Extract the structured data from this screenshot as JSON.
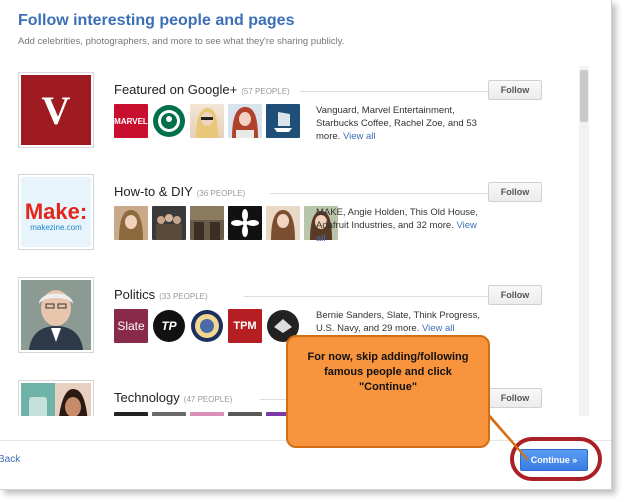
{
  "header": {
    "title": "Follow interesting people and pages",
    "subtitle": "Add celebrities, photographers, and more to see what they're sharing publicly."
  },
  "categories": [
    {
      "title": "Featured on Google+",
      "count": "(57 PEOPLE)",
      "follow_label": "Follow",
      "description": "Vanguard, Marvel Entertainment, Starbucks Coffee, Rachel Zoe, and 53 more.",
      "link": "View all"
    },
    {
      "title": "How-to & DIY",
      "count": "(36 PEOPLE)",
      "follow_label": "Follow",
      "description": "MAKE, Angie Holden, This Old House, Adafruit Industries, and 32 more.",
      "link": "View all"
    },
    {
      "title": "Politics",
      "count": "(33 PEOPLE)",
      "follow_label": "Follow",
      "description": "Bernie Sanders, Slate, Think Progress, U.S. Navy, and 29 more.",
      "link": "View all"
    },
    {
      "title": "Technology",
      "count": "(47 PEOPLE)",
      "follow_label": "Follow"
    }
  ],
  "logos": {
    "vanguard": "V",
    "make": "Make:",
    "makezine": "makezine.com",
    "marvel": "MARVEL",
    "slate": "Slate",
    "tp": "TP",
    "tpm": "TPM"
  },
  "footer": {
    "back_label": "Back",
    "continue_label": "Continue »"
  },
  "callout": {
    "text": "For now, skip adding/following famous people and click \"Continue\""
  },
  "colors": {
    "accent": "#3b6fb6",
    "callout": "#f7943d",
    "highlight_ring": "#a81f24"
  }
}
